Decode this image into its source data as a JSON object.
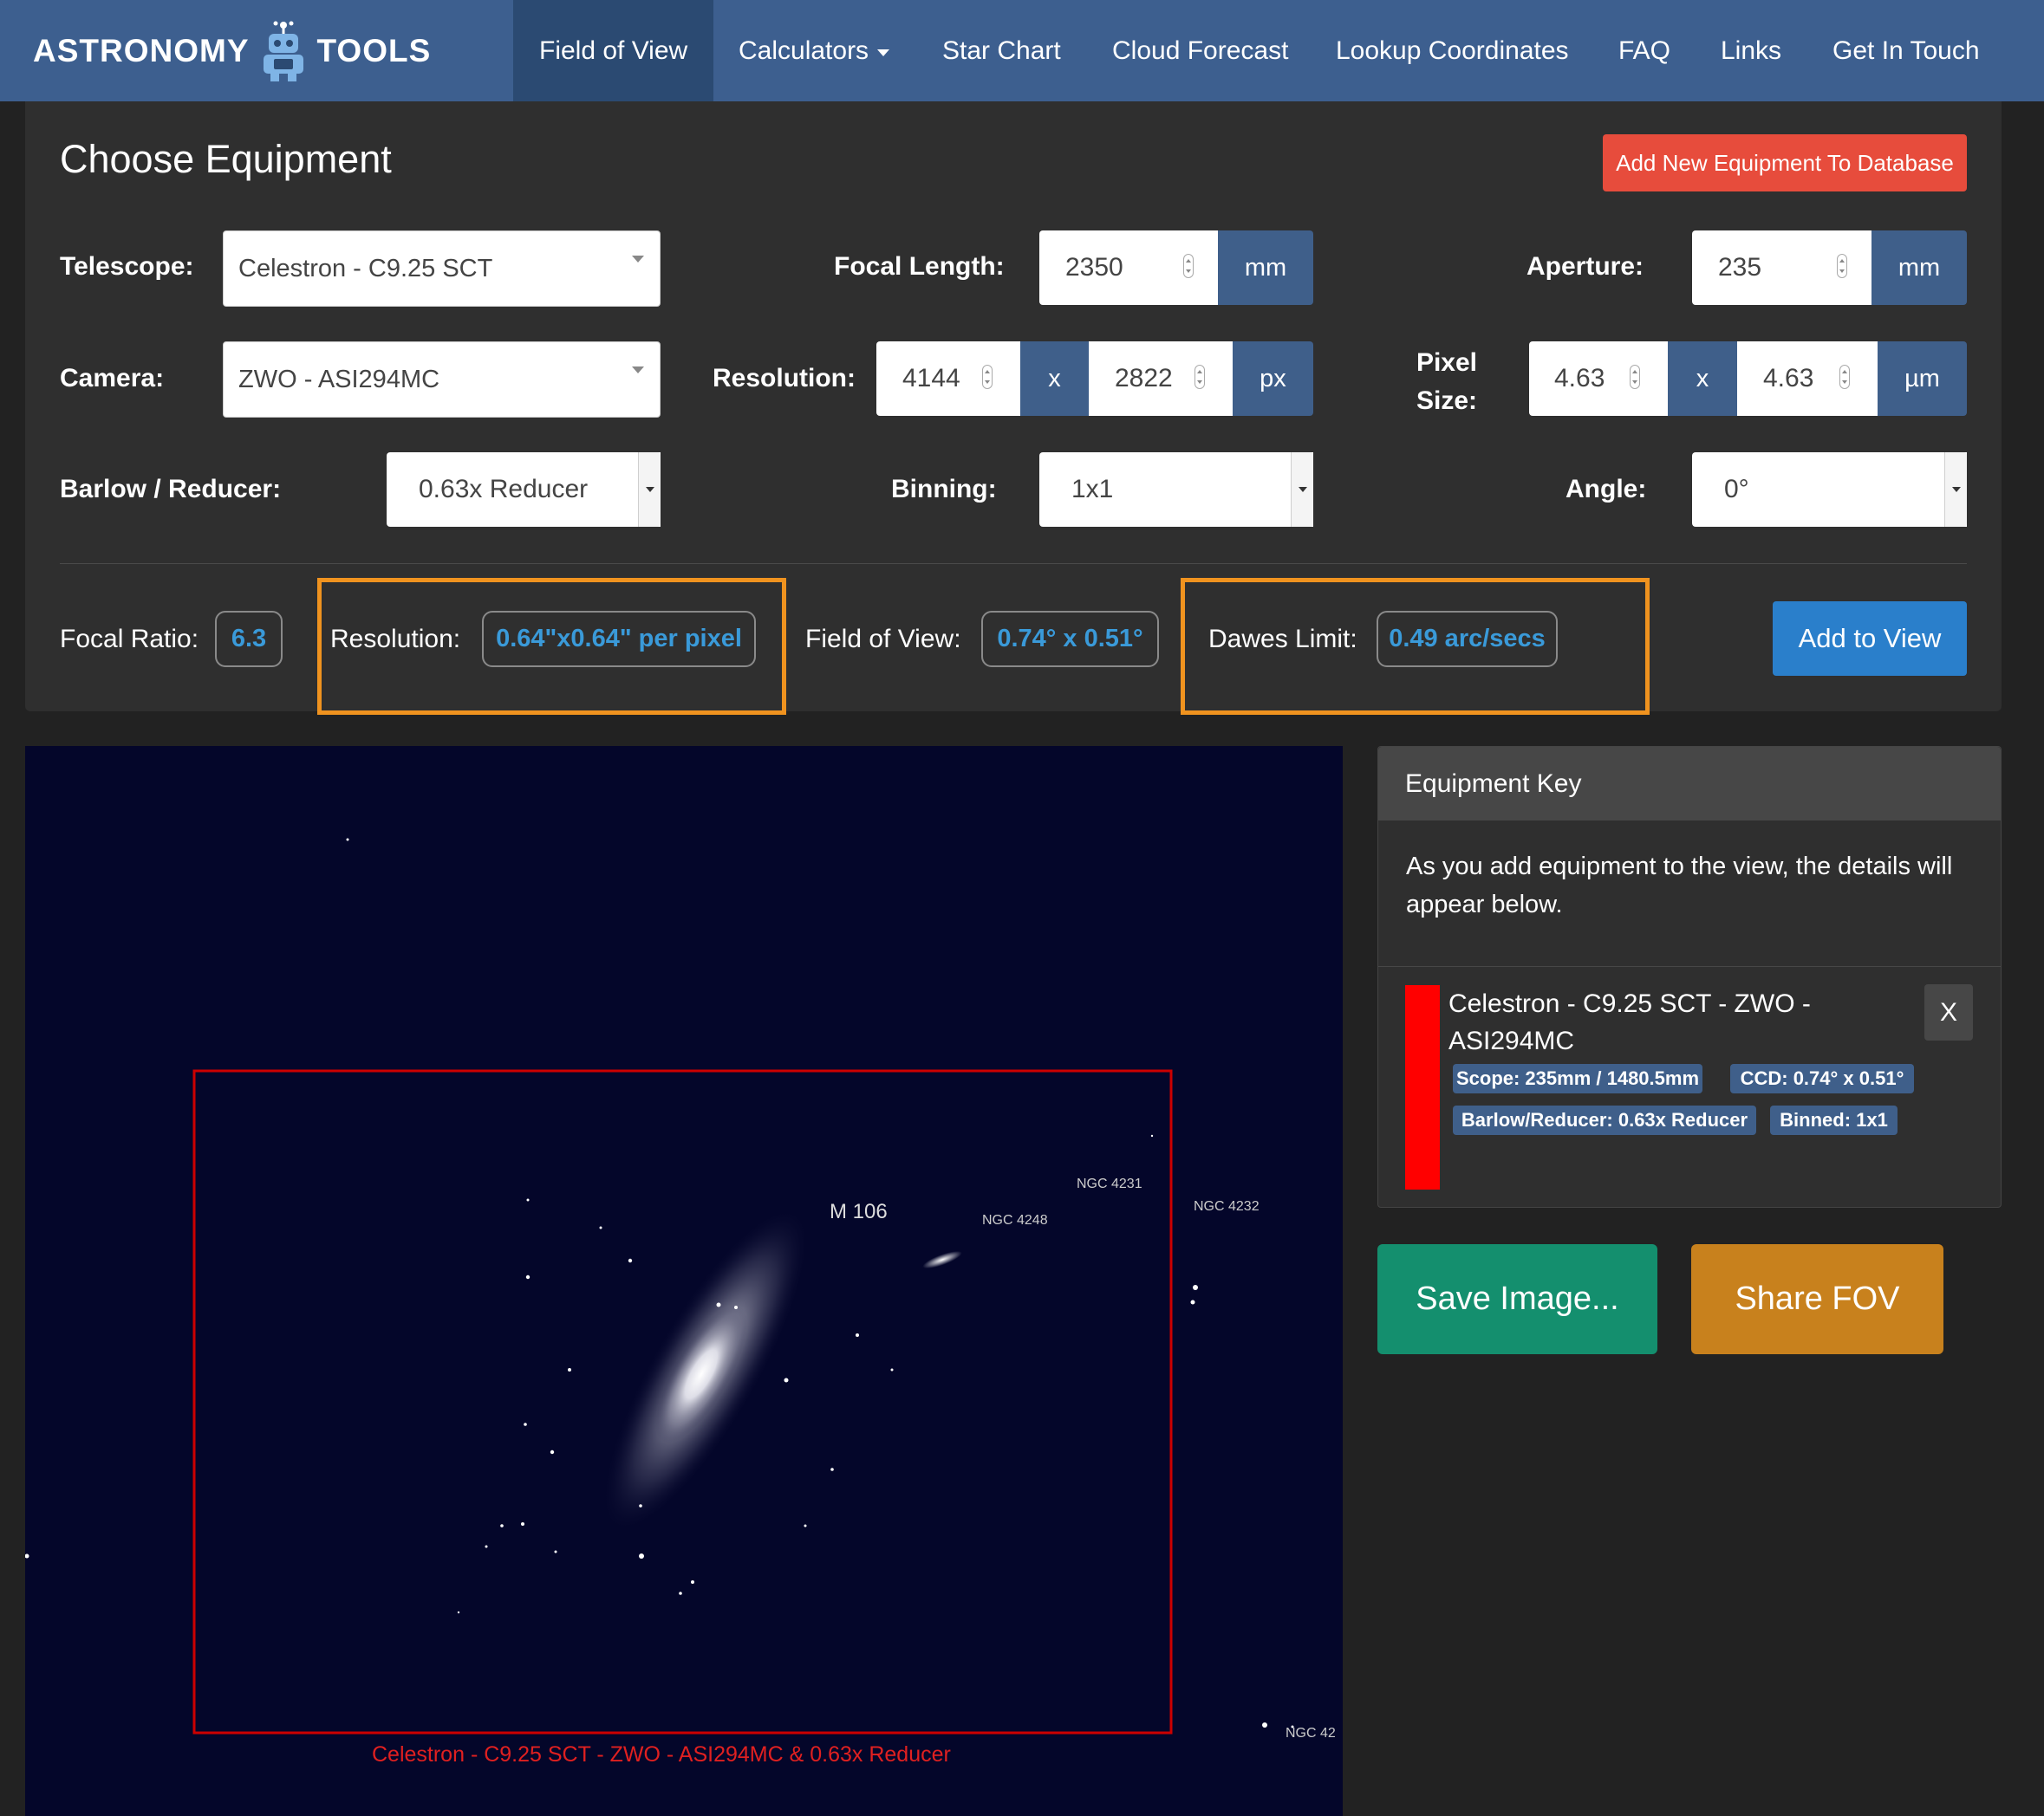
{
  "nav": {
    "logo_left": "ASTRONOMY",
    "logo_right": "TOOLS",
    "items": [
      {
        "label": "Field of View"
      },
      {
        "label": "Calculators"
      },
      {
        "label": "Star Chart"
      },
      {
        "label": "Cloud Forecast"
      },
      {
        "label": "Lookup Coordinates"
      },
      {
        "label": "FAQ"
      },
      {
        "label": "Links"
      },
      {
        "label": "Get In Touch"
      }
    ]
  },
  "equipment": {
    "title": "Choose Equipment",
    "add_new_label": "Add New Equipment To Database",
    "telescope_label": "Telescope:",
    "telescope_value": "Celestron - C9.25 SCT",
    "focal_length_label": "Focal Length:",
    "focal_length_value": "2350",
    "focal_length_unit": "mm",
    "aperture_label": "Aperture:",
    "aperture_value": "235",
    "aperture_unit": "mm",
    "camera_label": "Camera:",
    "camera_value": "ZWO - ASI294MC",
    "resolution_label": "Resolution:",
    "resolution_x": "4144",
    "resolution_sep": "x",
    "resolution_y": "2822",
    "resolution_unit": "px",
    "pixel_size_label_1": "Pixel",
    "pixel_size_label_2": "Size:",
    "pixel_x": "4.63",
    "pixel_sep": "x",
    "pixel_y": "4.63",
    "pixel_unit": "µm",
    "barlow_label": "Barlow / Reducer:",
    "barlow_value": "0.63x Reducer",
    "binning_label": "Binning:",
    "binning_value": "1x1",
    "angle_label": "Angle:",
    "angle_value": "0°"
  },
  "results": {
    "focal_ratio_label": "Focal Ratio:",
    "focal_ratio_value": "6.3",
    "resolution_label": "Resolution:",
    "resolution_value": "0.64\"x0.64\" per pixel",
    "fov_label": "Field of View:",
    "fov_value": "0.74° x 0.51°",
    "dawes_label": "Dawes Limit:",
    "dawes_value": "0.49 arc/secs",
    "add_to_view_label": "Add to View"
  },
  "sky": {
    "object_main": "M 106",
    "labels": [
      "NGC 4231",
      "NGC 4248",
      "NGC 4232",
      "NGC 42"
    ],
    "frame_caption": "Celestron - C9.25 SCT - ZWO - ASI294MC  & 0.63x Reducer",
    "frame_color": "#cc0000"
  },
  "key": {
    "title": "Equipment Key",
    "description": "As you add equipment to the view, the details will appear below.",
    "entry_name": "Celestron - C9.25 SCT - ZWO - ASI294MC",
    "entry_color": "#ff0000",
    "remove_label": "X",
    "tags": [
      "Scope: 235mm / 1480.5mm",
      "CCD: 0.74° x 0.51°",
      "Barlow/Reducer: 0.63x Reducer",
      "Binned: 1x1"
    ]
  },
  "actions": {
    "save_label": "Save Image...",
    "share_label": "Share FOV"
  },
  "colors": {
    "navbar": "#3d5f8f",
    "accent_blue": "#3a9ad9",
    "highlight_orange": "#f0931f",
    "danger": "#e74c3c",
    "success": "#148f6e",
    "warning": "#c8811d"
  }
}
